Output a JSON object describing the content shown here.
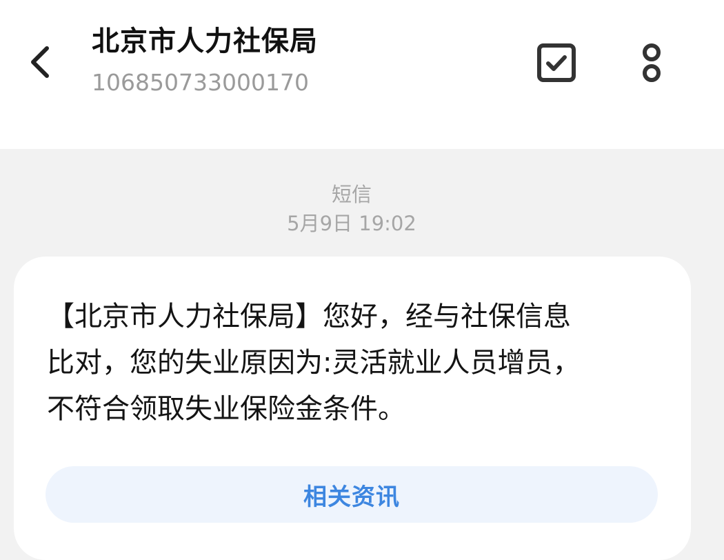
{
  "header": {
    "sender_name": "北京市人力社保局",
    "sender_number": "106850733000170",
    "back_icon": "chevron-left-icon",
    "select_icon": "checkbox-icon",
    "more_icon": "more-vertical-icon"
  },
  "message_meta": {
    "type": "短信",
    "timestamp": "5月9日 19:02"
  },
  "message": {
    "text": "【北京市人力社保局】您好，经与社保信息\n比对，您的失业原因为:灵活就业人员增员，\n不符合领取失业保险金条件。",
    "related_button_label": "相关资讯"
  },
  "colors": {
    "header_bg": "#ffffff",
    "page_bg": "#f2f2f2",
    "accent": "#3d86e0",
    "button_bg": "#eef4fd"
  }
}
